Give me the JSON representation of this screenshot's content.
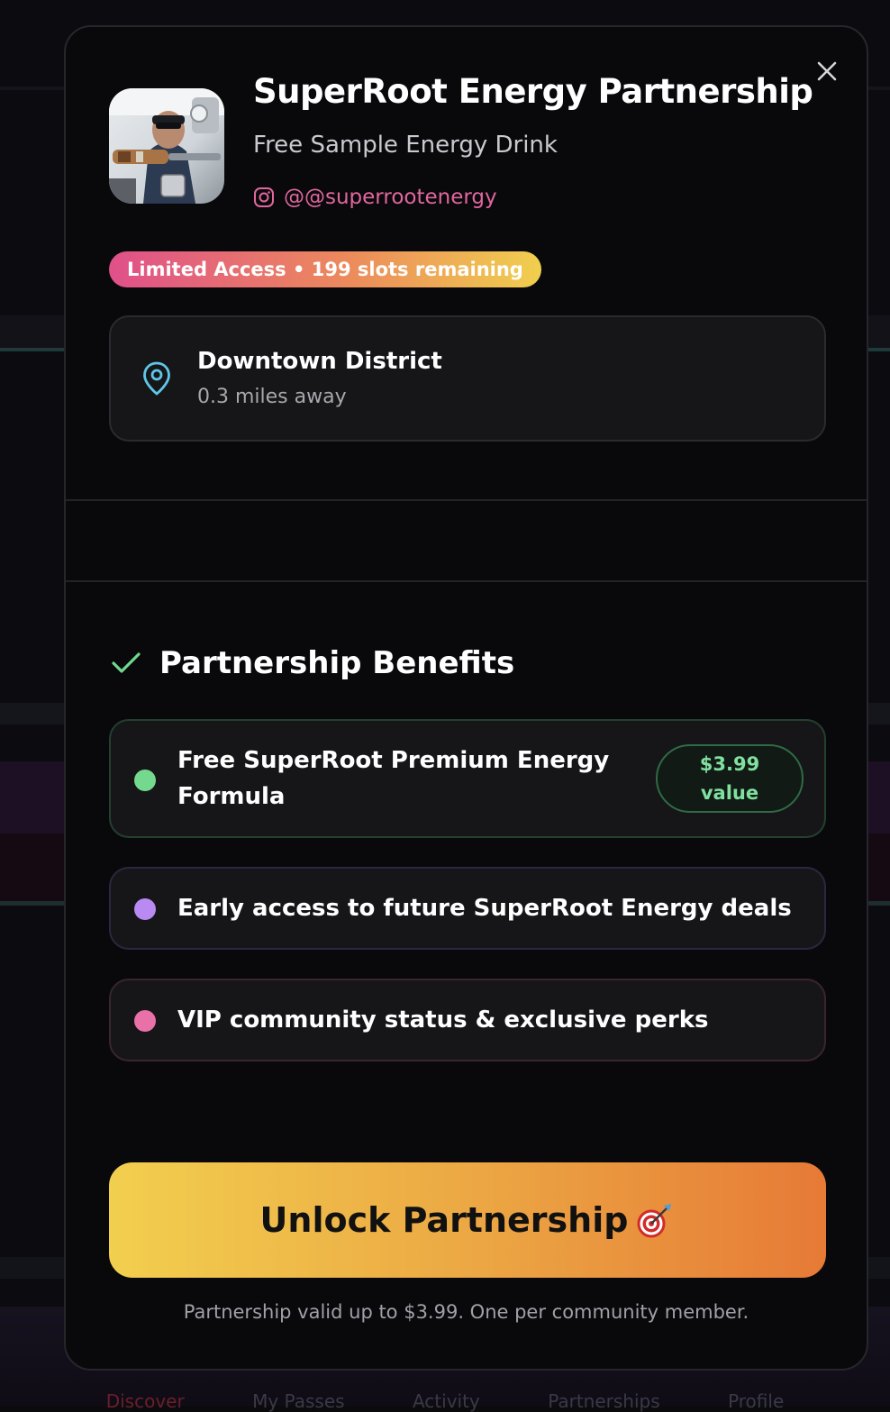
{
  "modal": {
    "title": "SuperRoot Energy Partnership",
    "subtitle": "Free Sample Energy Drink",
    "instagram_handle": "@@superrootenergy",
    "badge": "Limited Access • 199 slots remaining",
    "location": {
      "name": "Downtown District",
      "distance": "0.3 miles away"
    },
    "benefits_heading": "Partnership Benefits",
    "benefits": [
      {
        "text_line1": "Free SuperRoot Premium Energy",
        "text_line2": "Formula",
        "value_line1": "$3.99",
        "value_line2": "value",
        "dot_color": "#74d98e"
      },
      {
        "text": "Early access to future SuperRoot Energy deals",
        "dot_color": "#b88af2"
      },
      {
        "text": "VIP community status & exclusive perks",
        "dot_color": "#e871a8"
      }
    ],
    "cta_label": "Unlock Partnership",
    "cta_emoji": "🎯",
    "footnote": "Partnership valid up to $3.99. One per community member."
  },
  "background_nav": {
    "items": [
      "Discover",
      "My Passes",
      "Activity",
      "Partnerships",
      "Profile"
    ],
    "active": "Discover"
  },
  "colors": {
    "accent_pink": "#e0679e",
    "accent_green": "#7fe0a0",
    "cta_gradient_start": "#f2cf4e",
    "cta_gradient_end": "#e67a36"
  }
}
